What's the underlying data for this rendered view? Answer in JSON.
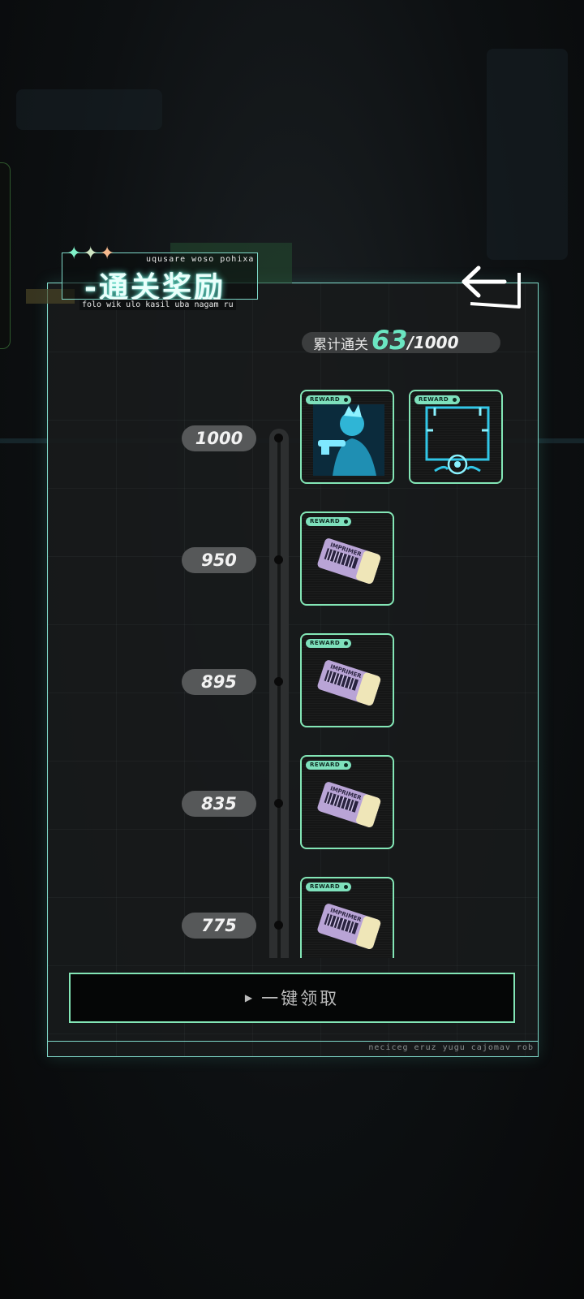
{
  "header": {
    "title": "-通关奖励",
    "subtitle_upper": "uqusare woso pohixa",
    "subtitle_lower": "folo wik ulo kasil uba nagam ru",
    "decor_stars": [
      "✦",
      "✦",
      "✦"
    ]
  },
  "back_button": {
    "icon": "back-arrow-icon"
  },
  "progress": {
    "label": "累计通关",
    "current": "63",
    "total": "/1000"
  },
  "rewards": [
    {
      "threshold": "1000",
      "items": [
        {
          "badge": "REWARD",
          "icon": "character-avatar-icon"
        },
        {
          "badge": "REWARD",
          "icon": "avatar-frame-icon"
        }
      ]
    },
    {
      "threshold": "950",
      "items": [
        {
          "badge": "REWARD",
          "icon": "imprimer-ticket-icon"
        }
      ]
    },
    {
      "threshold": "895",
      "items": [
        {
          "badge": "REWARD",
          "icon": "imprimer-ticket-icon"
        }
      ]
    },
    {
      "threshold": "835",
      "items": [
        {
          "badge": "REWARD",
          "icon": "imprimer-ticket-icon"
        }
      ]
    },
    {
      "threshold": "775",
      "items": [
        {
          "badge": "REWARD",
          "icon": "imprimer-ticket-icon"
        }
      ]
    }
  ],
  "ticket_label": "IMPRIMER",
  "claim_button": {
    "label": "一键领取"
  },
  "footer": {
    "text": "neciceg eruz yugu cajomav rob"
  },
  "colors": {
    "accent": "#83e6b6",
    "panel_border": "#7fd9c9",
    "progress_value": "#6be6c2"
  }
}
